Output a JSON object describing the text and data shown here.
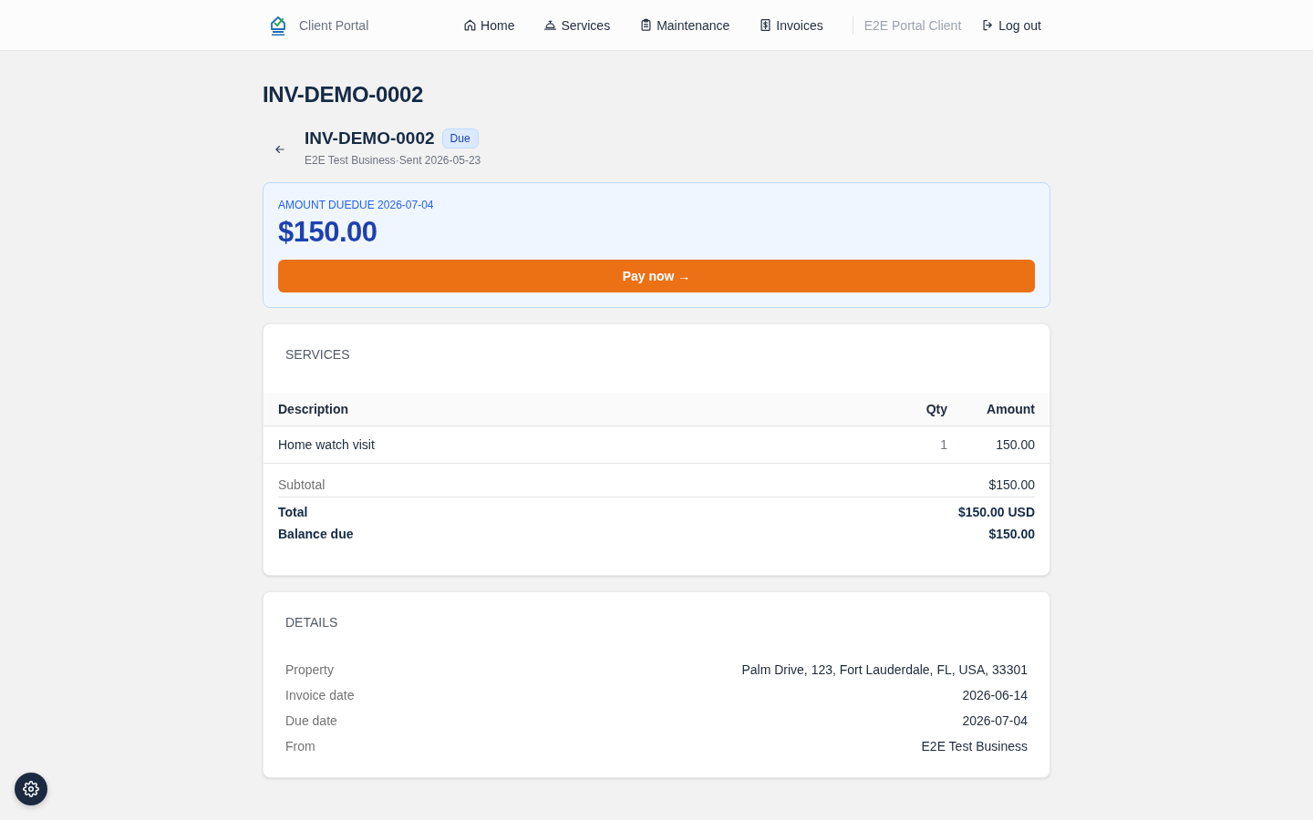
{
  "header": {
    "brand": "Client Portal",
    "nav": [
      {
        "label": "Home",
        "kind": "home"
      },
      {
        "label": "Services",
        "kind": "bell"
      },
      {
        "label": "Maintenance",
        "kind": "clipboard"
      },
      {
        "label": "Invoices",
        "kind": "receipt"
      }
    ],
    "user": "E2E Portal Client",
    "logout": "Log out"
  },
  "page_title": "INV-DEMO-0002",
  "invoice": {
    "number": "INV-DEMO-0002",
    "status": "Due",
    "subtitle": "E2E Test Business·Sent 2026-05-23"
  },
  "amount_card": {
    "label": "AMOUNT DUEDUE 2026-07-04",
    "amount": "$150.00",
    "pay_button": "Pay now →"
  },
  "services": {
    "heading": "SERVICES",
    "columns": [
      "Description",
      "Qty",
      "Amount"
    ],
    "rows": [
      [
        "Home watch visit",
        "1",
        "150.00"
      ]
    ],
    "totals": [
      {
        "kind": "subtotal",
        "label": "Subtotal",
        "value": "$150.00"
      },
      {
        "kind": "total",
        "label": "Total",
        "value": "$150.00 USD"
      },
      {
        "kind": "total",
        "label": "Balance due",
        "value": "$150.00"
      }
    ]
  },
  "details": {
    "heading": "DETAILS",
    "rows": [
      {
        "label": "Property",
        "value": "Palm Drive, 123, Fort Lauderdale, FL, USA, 33301"
      },
      {
        "label": "Invoice date",
        "value": "2026-06-14"
      },
      {
        "label": "Due date",
        "value": "2026-07-04"
      },
      {
        "label": "From",
        "value": "E2E Test Business"
      }
    ]
  }
}
